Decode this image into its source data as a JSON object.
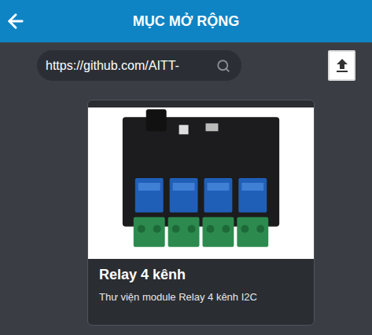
{
  "header": {
    "title": "MỤC MỞ RỘNG"
  },
  "search": {
    "value": "https://github.com/AITT-"
  },
  "extensions": [
    {
      "title": "Relay 4 kênh",
      "description": "Thư viện module Relay 4 kênh I2C"
    }
  ]
}
